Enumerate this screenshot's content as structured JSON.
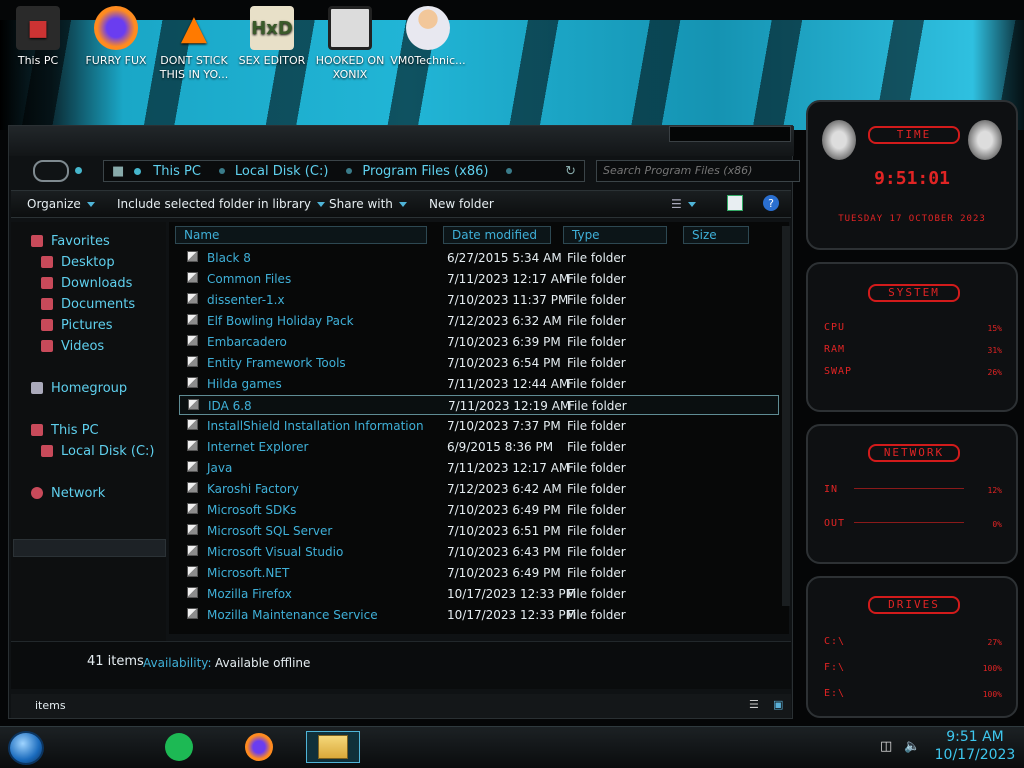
{
  "desktop_icons": [
    {
      "label": "This PC",
      "icon": "computer-icon"
    },
    {
      "label": "FURRY FUX",
      "icon": "firefox-icon"
    },
    {
      "label": "DONT STICK THIS IN YO...",
      "icon": "vlc-cone-icon"
    },
    {
      "label": "SEX EDITOR",
      "icon": "hex-editor-icon"
    },
    {
      "label": "HOOKED ON XONIX",
      "icon": "xonix-game-icon"
    },
    {
      "label": "VM0Technic...",
      "icon": "doctor-person-icon"
    }
  ],
  "explorer": {
    "breadcrumb": [
      "This PC",
      "Local Disk (C:)",
      "Program Files (x86)"
    ],
    "search_placeholder": "Search Program Files (x86)",
    "toolbar": {
      "organize": "Organize",
      "include": "Include selected folder in library",
      "share": "Share with",
      "new_folder": "New folder"
    },
    "nav": {
      "favorites": "Favorites",
      "fav_items": [
        "Desktop",
        "Downloads",
        "Documents",
        "Pictures",
        "Videos"
      ],
      "homegroup": "Homegroup",
      "this_pc": "This PC",
      "local_disk": "Local Disk (C:)",
      "network": "Network"
    },
    "columns": {
      "name": "Name",
      "date": "Date modified",
      "type": "Type",
      "size": "Size"
    },
    "rows": [
      {
        "name": "Black 8",
        "date": "6/27/2015 5:34 AM",
        "type": "File folder"
      },
      {
        "name": "Common Files",
        "date": "7/11/2023 12:17 AM",
        "type": "File folder"
      },
      {
        "name": "dissenter-1.x",
        "date": "7/10/2023 11:37 PM",
        "type": "File folder"
      },
      {
        "name": "Elf Bowling Holiday Pack",
        "date": "7/12/2023 6:32 AM",
        "type": "File folder"
      },
      {
        "name": "Embarcadero",
        "date": "7/10/2023 6:39 PM",
        "type": "File folder"
      },
      {
        "name": "Entity Framework Tools",
        "date": "7/10/2023 6:54 PM",
        "type": "File folder"
      },
      {
        "name": "Hilda games",
        "date": "7/11/2023 12:44 AM",
        "type": "File folder"
      },
      {
        "name": "IDA 6.8",
        "date": "7/11/2023 12:19 AM",
        "type": "File folder"
      },
      {
        "name": "InstallShield Installation Information",
        "date": "7/10/2023 7:37 PM",
        "type": "File folder"
      },
      {
        "name": "Internet Explorer",
        "date": "6/9/2015 8:36 PM",
        "type": "File folder"
      },
      {
        "name": "Java",
        "date": "7/11/2023 12:17 AM",
        "type": "File folder"
      },
      {
        "name": "Karoshi Factory",
        "date": "7/12/2023 6:42 AM",
        "type": "File folder"
      },
      {
        "name": "Microsoft SDKs",
        "date": "7/10/2023 6:49 PM",
        "type": "File folder"
      },
      {
        "name": "Microsoft SQL Server",
        "date": "7/10/2023 6:51 PM",
        "type": "File folder"
      },
      {
        "name": "Microsoft Visual Studio",
        "date": "7/10/2023 6:43 PM",
        "type": "File folder"
      },
      {
        "name": "Microsoft.NET",
        "date": "7/10/2023 6:49 PM",
        "type": "File folder"
      },
      {
        "name": "Mozilla Firefox",
        "date": "10/17/2023 12:33 PM",
        "type": "File folder"
      },
      {
        "name": "Mozilla Maintenance Service",
        "date": "10/17/2023 12:33 PM",
        "type": "File folder"
      }
    ],
    "selected_row": "IDA 6.8",
    "status": {
      "count": "41 items",
      "availability_label": "Availability:",
      "availability_value": "Available offline",
      "bottom_items": "items"
    }
  },
  "gadgets": {
    "time": {
      "title": "TIME",
      "clock": "9:51:01",
      "date": "TUESDAY 17 OCTOBER 2023"
    },
    "system": {
      "title": "SYSTEM",
      "cpu": "CPU",
      "cpu_val": "15%",
      "ram": "RAM",
      "ram_val": "31%",
      "swap": "SWAP",
      "swap_val": "26%"
    },
    "network": {
      "title": "NETWORK",
      "in": "IN",
      "in_val": "12%",
      "out": "OUT",
      "out_val": "0%"
    },
    "drives": {
      "title": "DRIVES",
      "rows": [
        {
          "label": "C:\\",
          "val": "27%"
        },
        {
          "label": "F:\\",
          "val": "100%"
        },
        {
          "label": "E:\\",
          "val": "100%"
        }
      ]
    }
  },
  "taskbar": {
    "time": "9:51 AM",
    "date": "10/17/2023"
  },
  "colors": {
    "accent": "#3fb0d8",
    "red": "#e02424"
  }
}
